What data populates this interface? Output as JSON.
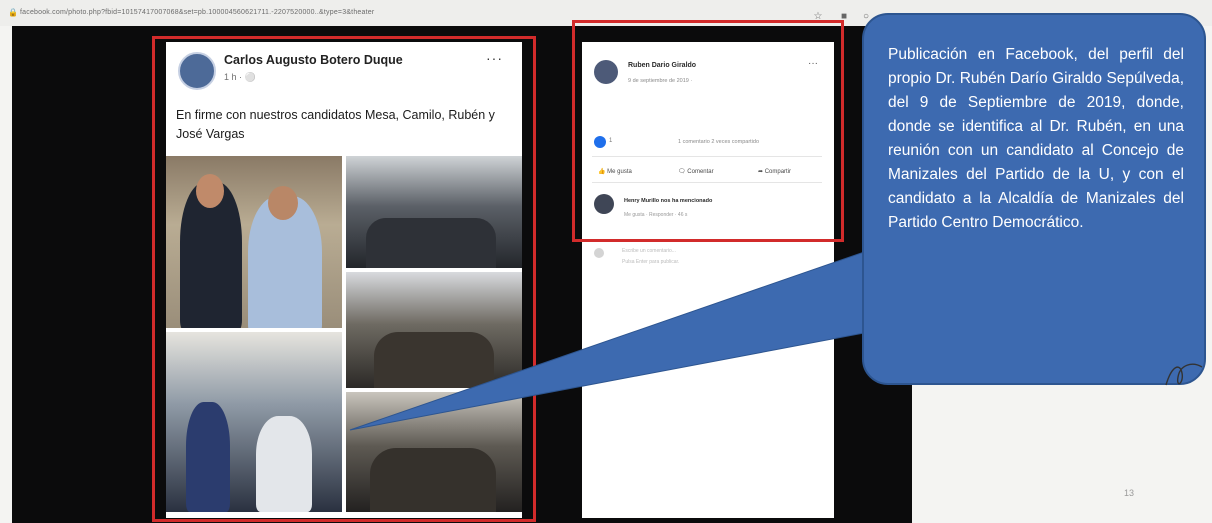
{
  "browser": {
    "url": "facebook.com/photo.php?fbid=10157417007068&set=pb.100004560621711.-2207520000..&type=3&theater",
    "toolbar_icons": [
      "star-icon",
      "extensions-icon",
      "account-icon"
    ]
  },
  "left_post": {
    "author": "Carlos Augusto Botero Duque",
    "time": "1 h ·",
    "text": "En firme con nuestros candidatos Mesa, Camilo, Rubén y José Vargas",
    "photo_count": 6
  },
  "right_post": {
    "author": "Ruben Dario Giraldo",
    "date": "9 de septiembre de 2019 ·",
    "reaction_count": "1",
    "stats": "1 comentario  2 veces compartido",
    "actions": [
      "Me gusta",
      "Comentar",
      "Compartir"
    ],
    "comment": {
      "author": "Henry Murillo nos ha mencionado",
      "meta": "Me gusta · Responder · 46 s"
    },
    "write_placeholder": "Escribe un comentario...",
    "write_hint": "Pulsa Enter para publicar."
  },
  "callout": {
    "text": "Publicación en Facebook, del perfil del propio Dr. Rubén Darío Giraldo Sepúlveda, del 9 de Septiembre de 2019, donde, donde se identifica al Dr. Rubén, en una reunión con un candidato al Concejo de Manizales del Partido de la U, y con el candidato a la Alcaldía de Manizales del Partido Centro Democrático."
  },
  "page_number": "13",
  "colors": {
    "highlight_border": "#d22b2b",
    "callout_fill": "#3d6ab0",
    "facebook_blue": "#1f6feb"
  }
}
